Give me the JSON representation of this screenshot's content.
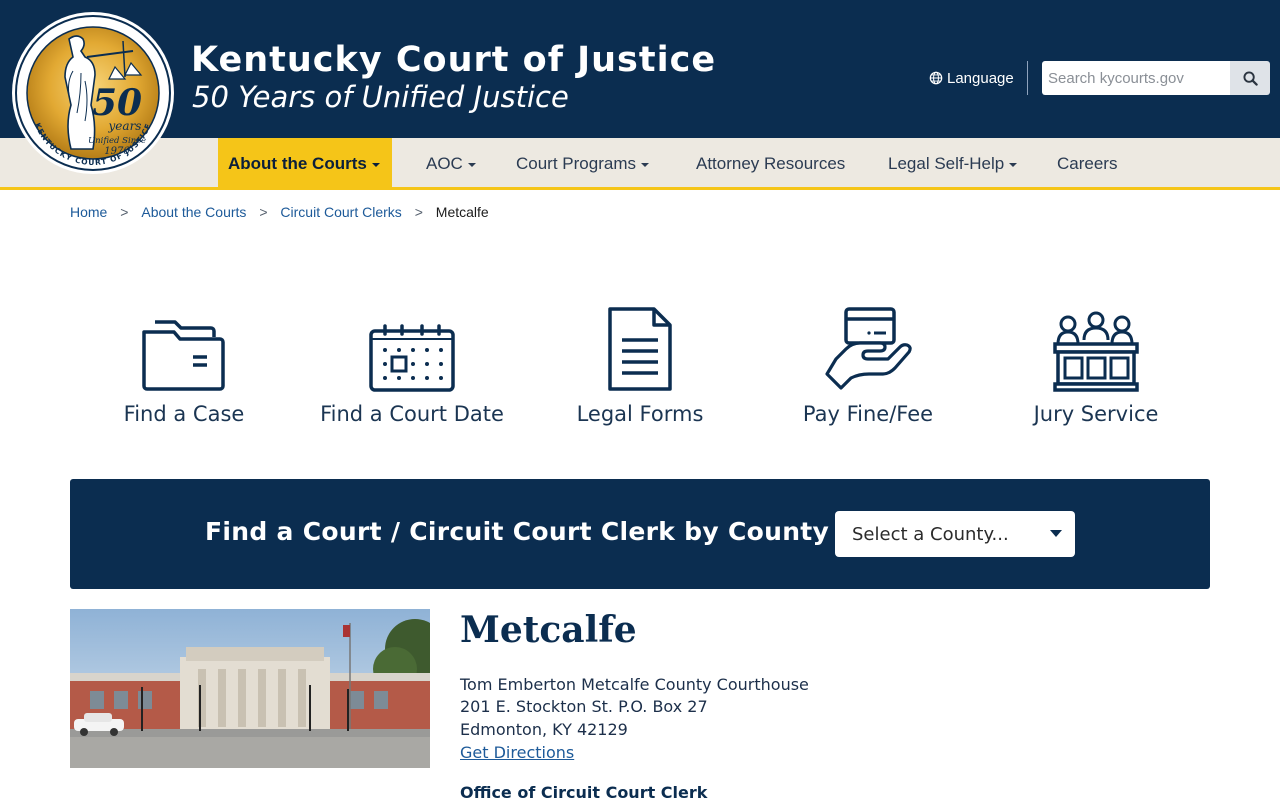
{
  "header": {
    "seal": {
      "number": "50",
      "word": "years",
      "since_line1": "Unified Since",
      "since_line2": "1976",
      "ring_text": "KENTUCKY COURT OF JUSTICE"
    },
    "title": "Kentucky Court of Justice",
    "subtitle": "50 Years of Unified Justice",
    "language_label": "Language",
    "search_placeholder": "Search kycourts.gov"
  },
  "nav": {
    "items": [
      {
        "label": "About the Courts",
        "active": true,
        "dropdown": true
      },
      {
        "label": "AOC",
        "dropdown": true
      },
      {
        "label": "Court Programs",
        "dropdown": true
      },
      {
        "label": "Attorney Resources",
        "dropdown": false
      },
      {
        "label": "Legal Self-Help",
        "dropdown": true
      },
      {
        "label": "Careers",
        "dropdown": false
      }
    ]
  },
  "breadcrumb": {
    "items": [
      "Home",
      "About the Courts",
      "Circuit Court Clerks"
    ],
    "current": "Metcalfe",
    "separator": ">"
  },
  "quick_links": [
    {
      "label": "Find a Case",
      "icon": "folder-icon"
    },
    {
      "label": "Find a Court Date",
      "icon": "calendar-icon"
    },
    {
      "label": "Legal Forms",
      "icon": "document-icon"
    },
    {
      "label": "Pay Fine/Fee",
      "icon": "hand-card-icon"
    },
    {
      "label": "Jury Service",
      "icon": "jury-box-icon"
    }
  ],
  "finder": {
    "title": "Find a Court / Circuit Court Clerk by County",
    "select_value": "Select a County..."
  },
  "court": {
    "name": "Metcalfe",
    "building": "Tom Emberton Metcalfe County Courthouse",
    "street": "201 E. Stockton St. P.O. Box 27",
    "city": "Edmonton, KY 42129",
    "directions_label": "Get Directions",
    "office_heading": "Office of Circuit Court Clerk"
  },
  "colors": {
    "navy": "#0b2d50",
    "gold": "#f5c518",
    "nav_bg": "#ede9e1",
    "link": "#1d5a99"
  }
}
